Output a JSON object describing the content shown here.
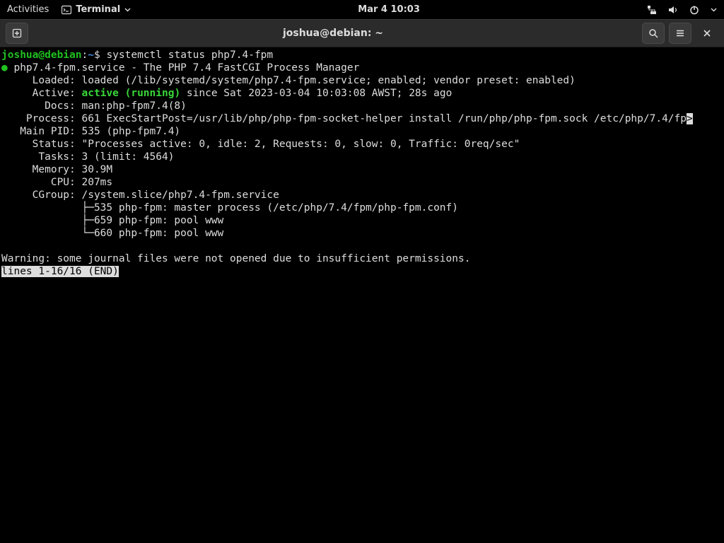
{
  "panel": {
    "activities": "Activities",
    "app_label": "Terminal",
    "clock": "Mar 4  10:03"
  },
  "window": {
    "title": "joshua@debian: ~"
  },
  "prompt": {
    "user_host": "joshua@debian",
    "sep": ":",
    "cwd": "~",
    "dollar": "$ ",
    "command": "systemctl status php7.4-fpm"
  },
  "status": {
    "bullet": "●",
    "unit_line": " php7.4-fpm.service - The PHP 7.4 FastCGI Process Manager",
    "loaded": "     Loaded: loaded (/lib/systemd/system/php7.4-fpm.service; enabled; vendor preset: enabled)",
    "active_l": "     Active: ",
    "active_v": "active (running)",
    "active_r": " since Sat 2023-03-04 10:03:08 AWST; 28s ago",
    "docs": "       Docs: man:php-fpm7.4(8)",
    "process": "    Process: 661 ExecStartPost=/usr/lib/php/php-fpm-socket-helper install /run/php/php-fpm.sock /etc/php/7.4/fp",
    "overflow": ">",
    "mainpid": "   Main PID: 535 (php-fpm7.4)",
    "statusl": "     Status: \"Processes active: 0, idle: 2, Requests: 0, slow: 0, Traffic: 0req/sec\"",
    "tasks": "      Tasks: 3 (limit: 4564)",
    "memory": "     Memory: 30.9M",
    "cpu": "        CPU: 207ms",
    "cgroup": "     CGroup: /system.slice/php7.4-fpm.service",
    "cg1": "             ├─535 php-fpm: master process (/etc/php/7.4/fpm/php-fpm.conf)",
    "cg2": "             ├─659 php-fpm: pool www",
    "cg3": "             └─660 php-fpm: pool www",
    "warning": "Warning: some journal files were not opened due to insufficient permissions.",
    "pager": "lines 1-16/16 (END)"
  }
}
